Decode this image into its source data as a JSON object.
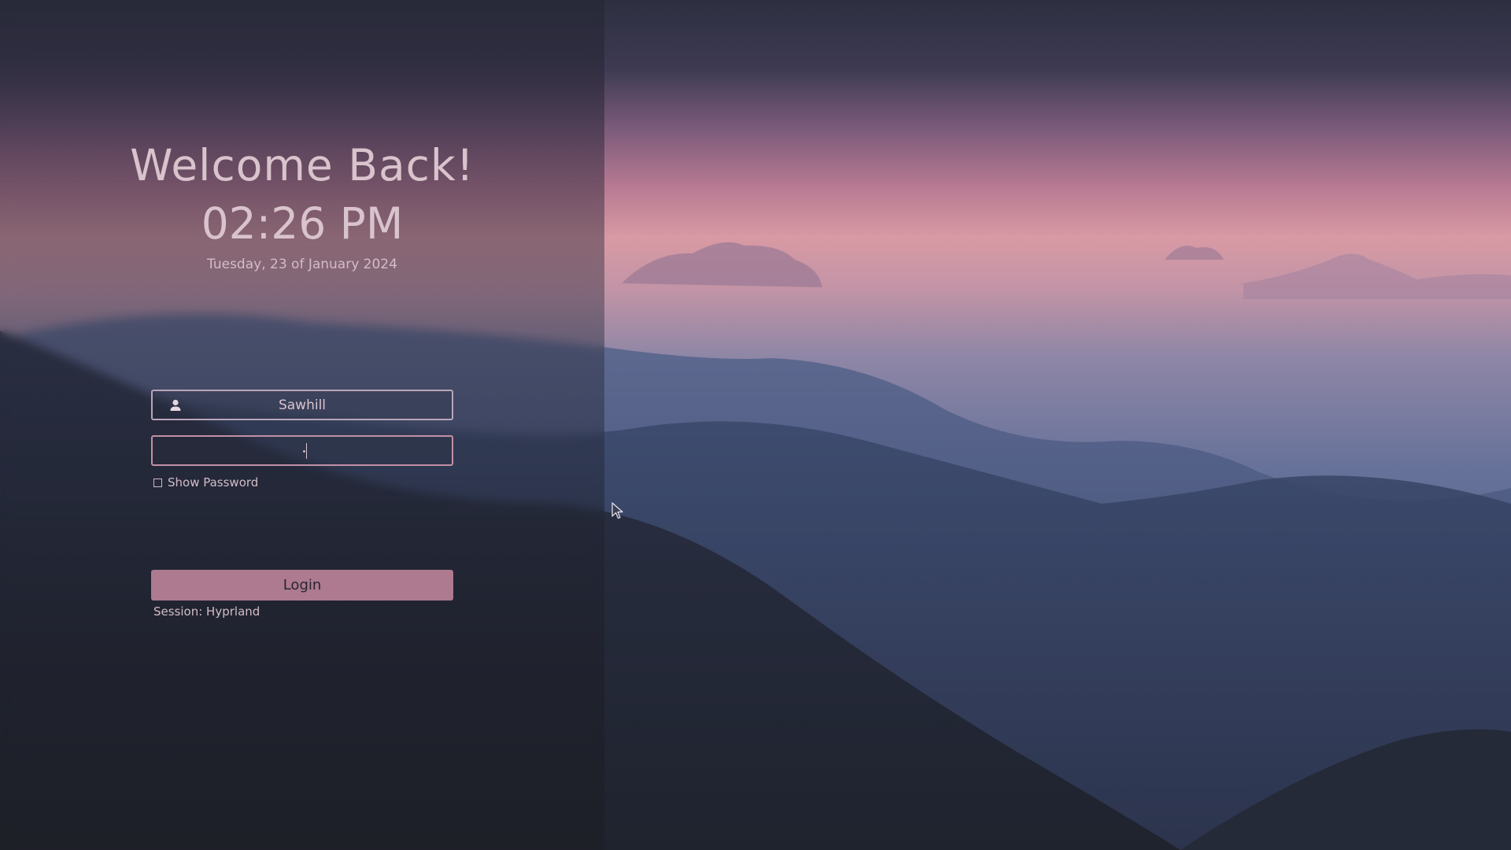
{
  "greeter": {
    "welcome": "Welcome Back!",
    "time": "02:26 PM",
    "date": "Tuesday, 23 of January 2024"
  },
  "form": {
    "username": "Sawhill",
    "username_icon": "user-icon",
    "password_mask": "•",
    "show_password_label": "Show Password",
    "show_password_checked": false,
    "login_label": "Login",
    "session_label": "Session: Hyprland"
  },
  "colors": {
    "accent": "#ad7a90",
    "text": "#d9c3cc",
    "field_border": "#b8a6ba",
    "focus_border": "#c290a6"
  }
}
